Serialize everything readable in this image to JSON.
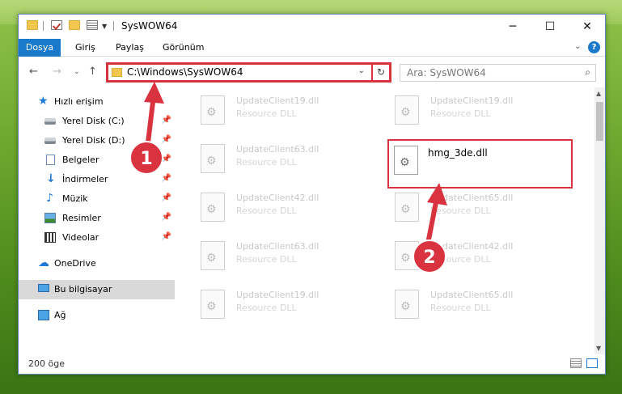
{
  "title": {
    "window_title": "SysWOW64"
  },
  "ribbon": {
    "tabs": [
      {
        "label": "Dosya"
      },
      {
        "label": "Giriş"
      },
      {
        "label": "Paylaş"
      },
      {
        "label": "Görünüm"
      }
    ]
  },
  "address": {
    "path": "C:\\Windows\\SysWOW64",
    "search_placeholder": "Ara: SysWOW64"
  },
  "sidebar": {
    "items": [
      {
        "label": "Hızlı erişim",
        "icon": "star-icon"
      },
      {
        "label": "Yerel Disk (C:)",
        "icon": "disk-icon",
        "pinned": true
      },
      {
        "label": "Yerel Disk (D:)",
        "icon": "disk-icon",
        "pinned": true
      },
      {
        "label": "Belgeler",
        "icon": "document-icon",
        "pinned": true
      },
      {
        "label": "İndirmeler",
        "icon": "download-icon",
        "pinned": true
      },
      {
        "label": "Müzik",
        "icon": "music-icon",
        "pinned": true
      },
      {
        "label": "Resimler",
        "icon": "pictures-icon",
        "pinned": true
      },
      {
        "label": "Videolar",
        "icon": "videos-icon",
        "pinned": true
      },
      {
        "label": "OneDrive",
        "icon": "cloud-icon"
      },
      {
        "label": "Bu bilgisayar",
        "icon": "computer-icon",
        "selected": true
      },
      {
        "label": "Ağ",
        "icon": "network-icon"
      }
    ]
  },
  "files": [
    {
      "name": "UpdateClient19.dll",
      "type": "Resource DLL"
    },
    {
      "name": "UpdateClient19.dll",
      "type": "Resource DLL"
    },
    {
      "name": "UpdateClient63.dll",
      "type": "Resource DLL"
    },
    {
      "name": "hmg_3de.dll",
      "type": ""
    },
    {
      "name": "UpdateClient42.dll",
      "type": "Resource DLL"
    },
    {
      "name": "UpdateClient65.dll",
      "type": "Resource DLL"
    },
    {
      "name": "UpdateClient63.dll",
      "type": "Resource DLL"
    },
    {
      "name": "UpdateClient42.dll",
      "type": "Resource DLL"
    },
    {
      "name": "UpdateClient19.dll",
      "type": "Resource DLL"
    },
    {
      "name": "UpdateClient65.dll",
      "type": "Resource DLL"
    }
  ],
  "status": {
    "item_count": "200 öge"
  },
  "annotations": {
    "badge1": "1",
    "badge2": "2"
  },
  "colors": {
    "accent": "#1979ca",
    "highlight": "#d9333f",
    "selection": "#d9d9d9"
  }
}
